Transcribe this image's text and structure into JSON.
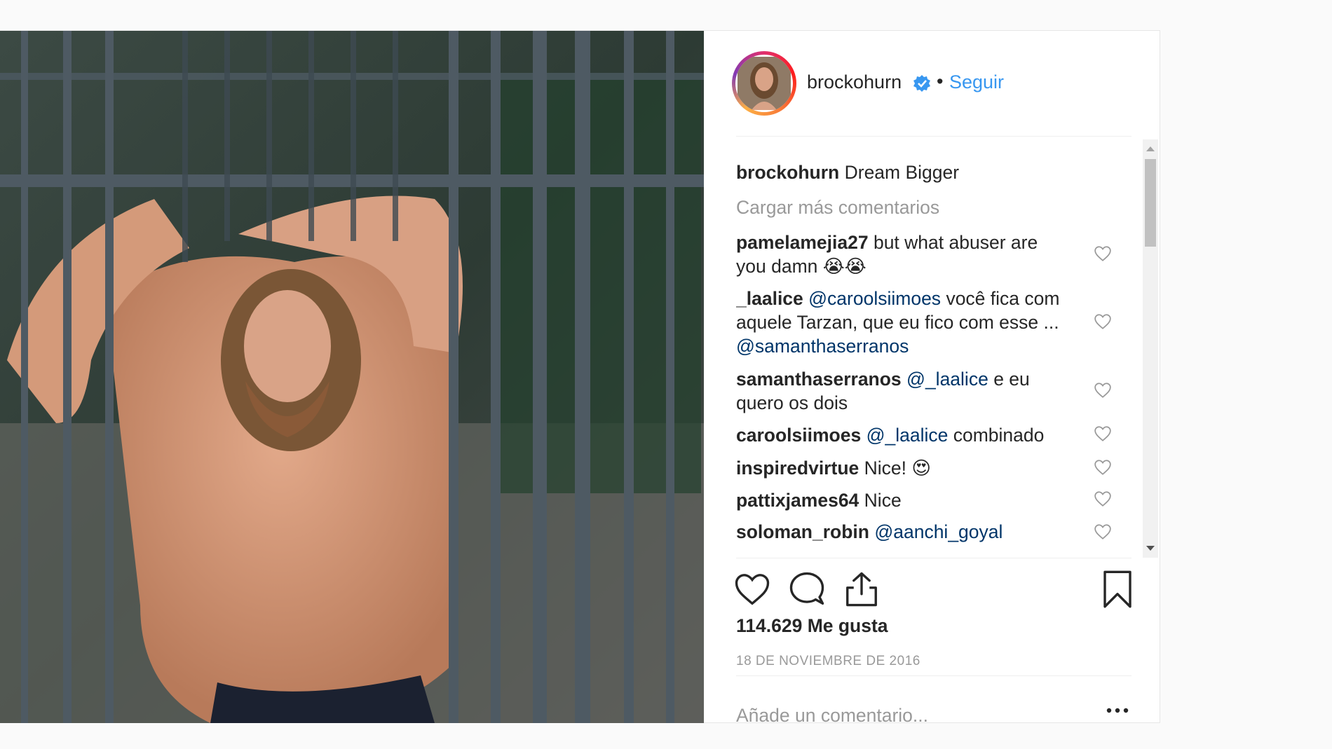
{
  "header": {
    "username": "brockohurn",
    "separator": "•",
    "follow_label": "Seguir"
  },
  "comments": [
    {
      "user": "brockohurn",
      "text": "Dream Bigger",
      "is_caption": true
    },
    {
      "load_more": "Cargar más comentarios"
    },
    {
      "user": "pamelamejia27",
      "text_line1": "but what abuser are",
      "text_line2": "you damn",
      "emoji": "😭😭"
    },
    {
      "user": "_laalice",
      "mention1": "@caroolsiimoes",
      "text_line1": "você fica com",
      "text_line2": "aquele Tarzan, que eu fico com esse ...",
      "mention2": "@samanthaserranos"
    },
    {
      "user": "samanthaserranos",
      "mention1": "@_laalice",
      "text_line1": "e eu",
      "text_line2": "quero os dois"
    },
    {
      "user": "caroolsiimoes",
      "mention1": "@_laalice",
      "text_line1": "combinado"
    },
    {
      "user": "inspiredvirtue",
      "text_line1": "Nice!",
      "emoji": "😍"
    },
    {
      "user": "pattixjames64",
      "text_line1": "Nice"
    },
    {
      "user": "soloman_robin",
      "mention1": "@aanchi_goyal"
    }
  ],
  "likes_label": "114.629 Me gusta",
  "date_label": "18 DE NOVIEMBRE DE 2016",
  "add_comment_placeholder": "Añade un comentario...",
  "icons": {
    "verified": "verified-badge-icon",
    "like": "heart-icon",
    "comment": "comment-bubble-icon",
    "share": "share-icon",
    "save": "bookmark-icon",
    "options": "more-options-icon"
  },
  "colors": {
    "link": "#3897f0",
    "mention": "#003569",
    "muted": "#999999",
    "verified": "#3897f0"
  }
}
